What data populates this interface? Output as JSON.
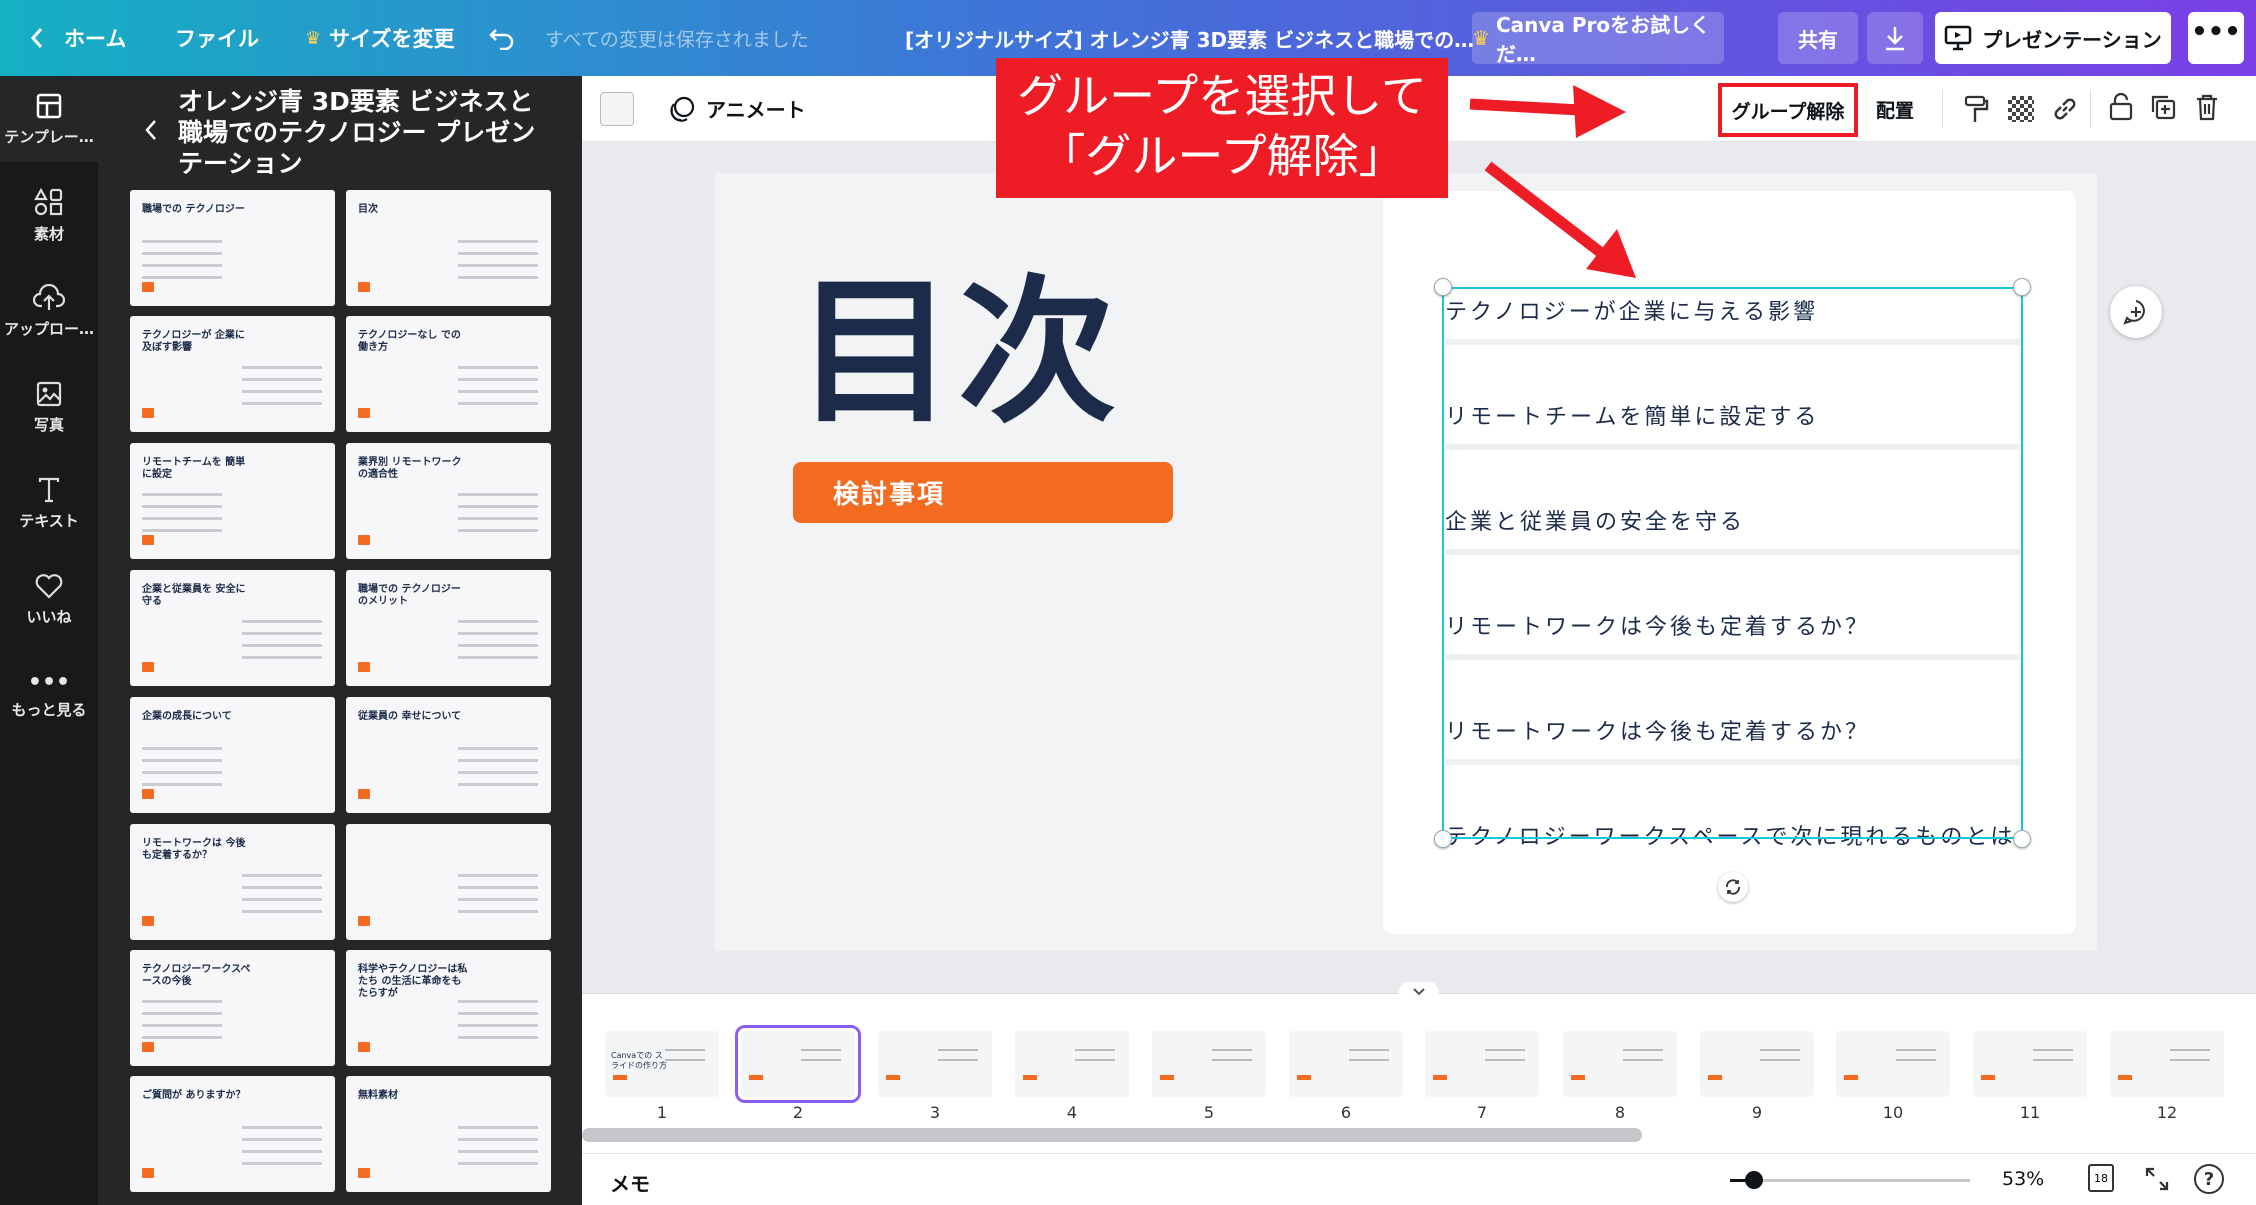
{
  "topbar": {
    "home": "ホーム",
    "file": "ファイル",
    "resize": "サイズを変更",
    "save_status": "すべての変更は保存されました",
    "doc_title": "[オリジナルサイズ] オレンジ青 3D要素 ビジネスと職場での…",
    "try_pro": "Canva Proをお試しくだ…",
    "share": "共有",
    "present": "プレゼンテーション"
  },
  "rail": [
    {
      "label": "テンプレー…",
      "icon": "template-icon"
    },
    {
      "label": "素材",
      "icon": "elements-icon"
    },
    {
      "label": "アップロー…",
      "icon": "upload-icon"
    },
    {
      "label": "写真",
      "icon": "photo-icon"
    },
    {
      "label": "テキスト",
      "icon": "text-icon"
    },
    {
      "label": "いいね",
      "icon": "heart-icon"
    },
    {
      "label": "もっと見る",
      "icon": "more-icon"
    }
  ],
  "panel": {
    "title": "オレンジ青 3D要素 ビジネスと職場でのテクノロジー プレゼンテーション",
    "thumbs": [
      {
        "text": "職場での テクノロジー"
      },
      {
        "text": "目次"
      },
      {
        "text": "テクノロジーが 企業に及ぼす影響"
      },
      {
        "text": "テクノロジーなし での働き方"
      },
      {
        "text": "リモートチームを 簡単に設定"
      },
      {
        "text": "業界別 リモートワーク の適合性"
      },
      {
        "text": "企業と従業員を 安全に守る"
      },
      {
        "text": "職場での テクノロジー のメリット"
      },
      {
        "text": "企業の成長について"
      },
      {
        "text": "従業員の 幸せについて"
      },
      {
        "text": "リモートワークは 今後も定着するか？"
      },
      {
        "text": ""
      },
      {
        "text": "テクノロジーワークスペースの今後"
      },
      {
        "text": "科学やテクノロジーは私たち の生活に革命をもたらすが"
      },
      {
        "text": "ご質問が ありますか？"
      },
      {
        "text": "無料素材"
      }
    ]
  },
  "ctxbar": {
    "animate": "アニメート",
    "ungroup": "グループ解除",
    "arrange": "配置"
  },
  "slide": {
    "heading": "目次",
    "badge": "検討事項",
    "items": [
      "テクノロジーが企業に与える影響",
      "リモートチームを簡単に設定する",
      "企業と従業員の安全を守る",
      "リモートワークは今後も定着するか？",
      "リモートワークは今後も定着するか？",
      "テクノロジーワークスペースで次に現れるものとは"
    ]
  },
  "callout": {
    "line1": "グループを選択して",
    "line2": "「グループ解除」"
  },
  "filmstrip": {
    "pages": [
      "1",
      "2",
      "3",
      "4",
      "5",
      "6",
      "7",
      "8",
      "9",
      "10",
      "11",
      "12"
    ],
    "first_text": "Canvaでの スライドの作り方"
  },
  "bottombar": {
    "notes": "メモ",
    "zoom": "53%",
    "page_count": "18",
    "zoom_level": 0.1
  },
  "colors": {
    "accent_orange": "#f26b21",
    "navy": "#1c2b4a",
    "selection": "#18c7d8",
    "callout_red": "#ee1c24"
  }
}
